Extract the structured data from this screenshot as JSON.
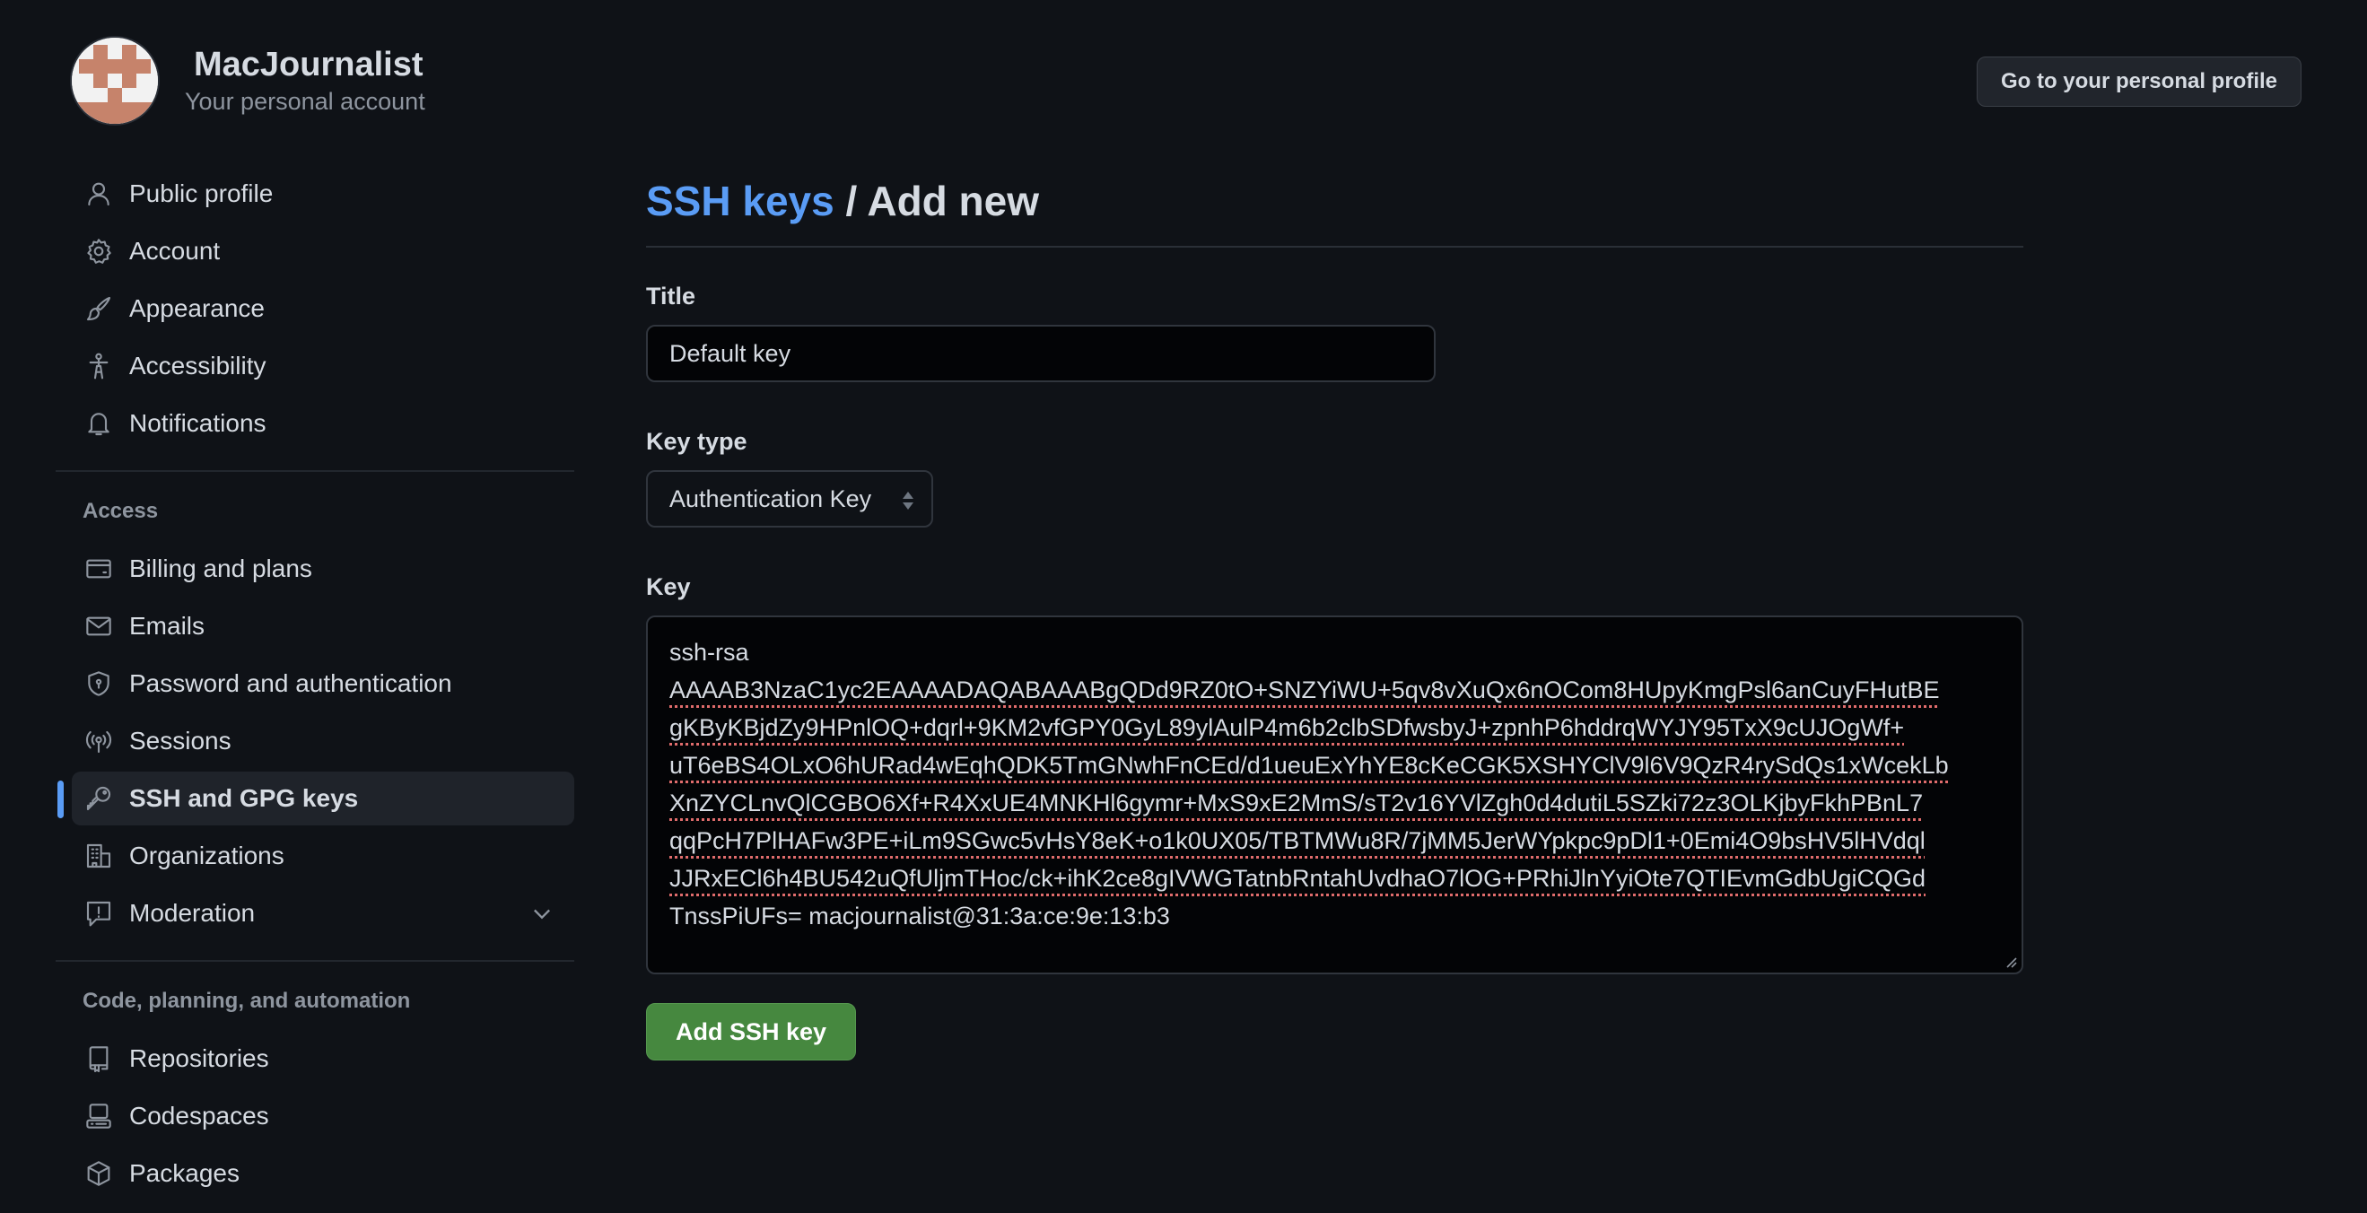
{
  "header": {
    "username": "MacJournalist",
    "subtitle": "Your personal account",
    "profile_button": "Go to your personal profile"
  },
  "sidebar": {
    "items_top": [
      {
        "label": "Public profile",
        "icon": "person-icon"
      },
      {
        "label": "Account",
        "icon": "gear-icon"
      },
      {
        "label": "Appearance",
        "icon": "paintbrush-icon"
      },
      {
        "label": "Accessibility",
        "icon": "accessibility-icon"
      },
      {
        "label": "Notifications",
        "icon": "bell-icon"
      }
    ],
    "section_access": "Access",
    "items_access": [
      {
        "label": "Billing and plans",
        "icon": "credit-card-icon"
      },
      {
        "label": "Emails",
        "icon": "mail-icon"
      },
      {
        "label": "Password and authentication",
        "icon": "shield-lock-icon"
      },
      {
        "label": "Sessions",
        "icon": "broadcast-icon"
      },
      {
        "label": "SSH and GPG keys",
        "icon": "key-icon",
        "active": true
      },
      {
        "label": "Organizations",
        "icon": "organization-icon"
      },
      {
        "label": "Moderation",
        "icon": "report-icon",
        "expandable": true
      }
    ],
    "section_code": "Code, planning, and automation",
    "items_code": [
      {
        "label": "Repositories",
        "icon": "repo-icon"
      },
      {
        "label": "Codespaces",
        "icon": "codespaces-icon"
      },
      {
        "label": "Packages",
        "icon": "package-icon"
      }
    ]
  },
  "main": {
    "breadcrumb_link": "SSH keys",
    "breadcrumb_sep": " / ",
    "breadcrumb_current": "Add new",
    "title_label": "Title",
    "title_value": "Default key",
    "key_type_label": "Key type",
    "key_type_value": "Authentication Key",
    "key_label": "Key",
    "key_lines": [
      "ssh-rsa",
      "AAAAB3NzaC1yc2EAAAADAQABAAABgQDd9RZ0tO+SNZYiWU+5qv8vXuQx6nOCom8HUpyKmgPsl6anCuyFHutBE",
      "gKByKBjdZy9HPnlOQ+dqrl+9KM2vfGPY0GyL89ylAulP4m6b2clbSDfwsbyJ+zpnhP6hddrqWYJY95TxX9cUJOgWf+",
      "uT6eBS4OLxO6hURad4wEqhQDK5TmGNwhFnCEd/d1ueuExYhYE8cKeCGK5XSHYClV9l6V9QzR4rySdQs1xWcekLb",
      "XnZYCLnvQlCGBO6Xf+R4XxUE4MNKHl6gymr+MxS9xE2MmS/sT2v16YVlZgh0d4dutiL5SZki72z3OLKjbyFkhPBnL7",
      "qqPcH7PlHAFw3PE+iLm9SGwc5vHsY8eK+o1k0UX05/TBTMWu8R/7jMM5JerWYpkpc9pDl1+0Emi4O9bsHV5lHVdql",
      "JJRxECl6h4BU542uQfUljmTHoc/ck+ihK2ce8gIVWGTatnbRntahUvdhaO7lOG+PRhiJlnYyiOte7QTIEvmGdbUgiCQGd",
      "TnssPiUFs= macjournalist@31:3a:ce:9e:13:b3"
    ],
    "submit_button": "Add SSH key"
  },
  "colors": {
    "background": "#0f1217",
    "accent_link": "#5a9cf5",
    "primary_button": "#46883f",
    "spellcheck_underline": "#e06c6c",
    "avatar_brand": "#c6836b"
  }
}
